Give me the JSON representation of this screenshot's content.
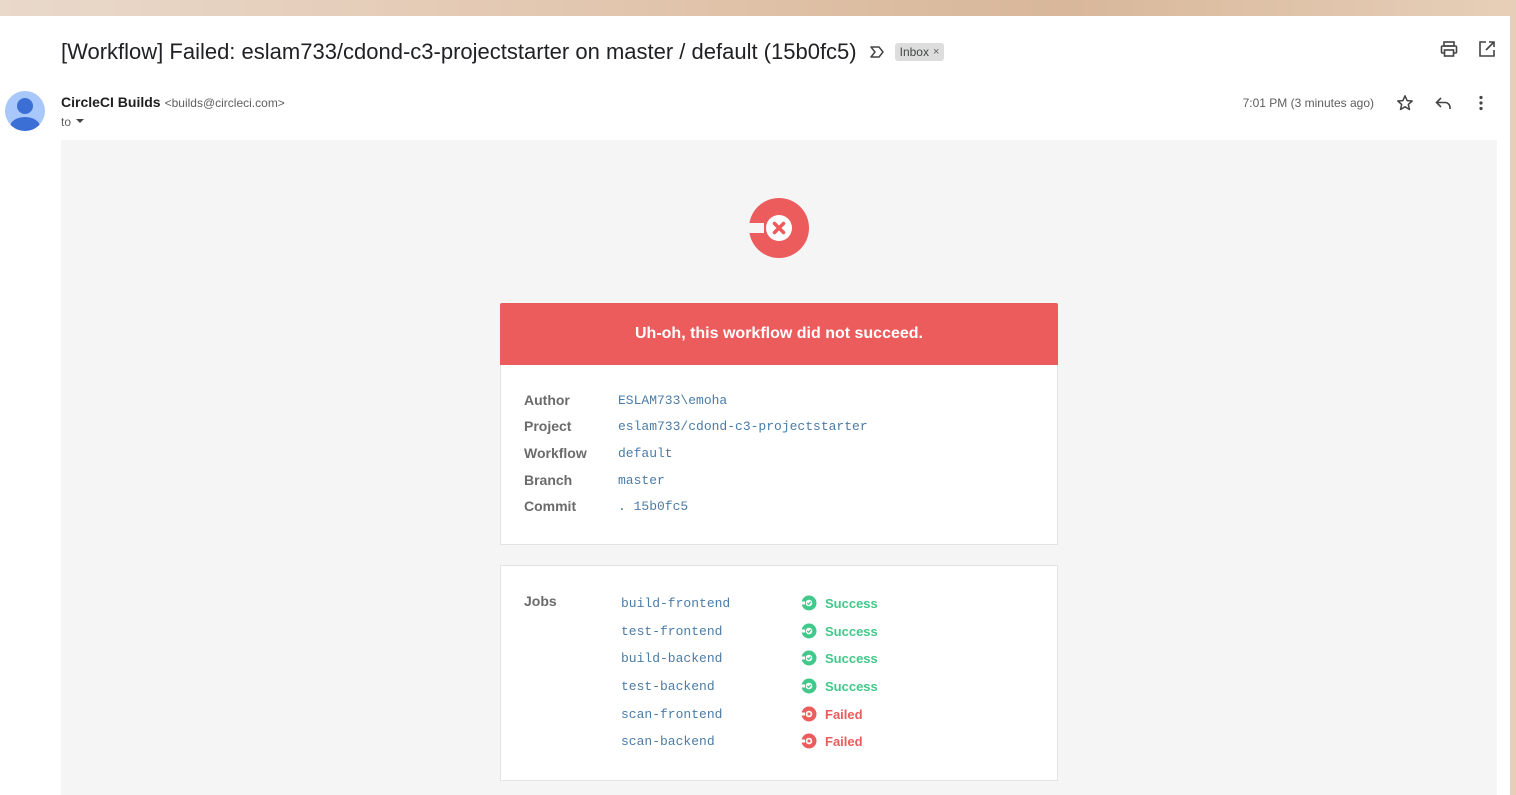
{
  "email": {
    "subject": "[Workflow] Failed: eslam733/cdond-c3-projectstarter on master / default (15b0fc5)",
    "label": "Inbox",
    "label_close": "×",
    "sender_name": "CircleCI Builds",
    "sender_email": "<builds@circleci.com>",
    "to_label": "to",
    "timestamp": "7:01 PM (3 minutes ago)",
    "icons": [
      "important-icon",
      "print-icon",
      "open-in-new-window-icon",
      "star-icon",
      "reply-icon",
      "more-vert-icon",
      "chevron-down-icon",
      "avatar-person-icon"
    ]
  },
  "notification": {
    "headline": "Uh-oh, this workflow did not succeed.",
    "colors": {
      "failed": "#ec5c5c",
      "success": "#42c88a",
      "link": "#4a7ca8"
    },
    "info": [
      {
        "label": "Author",
        "value": "ESLAM733\\emoha"
      },
      {
        "label": "Project",
        "value": "eslam733/cdond-c3-projectstarter"
      },
      {
        "label": "Workflow",
        "value": "default"
      },
      {
        "label": "Branch",
        "value": "master"
      },
      {
        "label": "Commit",
        "value": ". 15b0fc5"
      }
    ],
    "jobs_label": "Jobs",
    "jobs": [
      {
        "name": "build-frontend",
        "status": "Success"
      },
      {
        "name": "test-frontend",
        "status": "Success"
      },
      {
        "name": "build-backend",
        "status": "Success"
      },
      {
        "name": "test-backend",
        "status": "Success"
      },
      {
        "name": "scan-frontend",
        "status": "Failed"
      },
      {
        "name": "scan-backend",
        "status": "Failed"
      }
    ]
  }
}
